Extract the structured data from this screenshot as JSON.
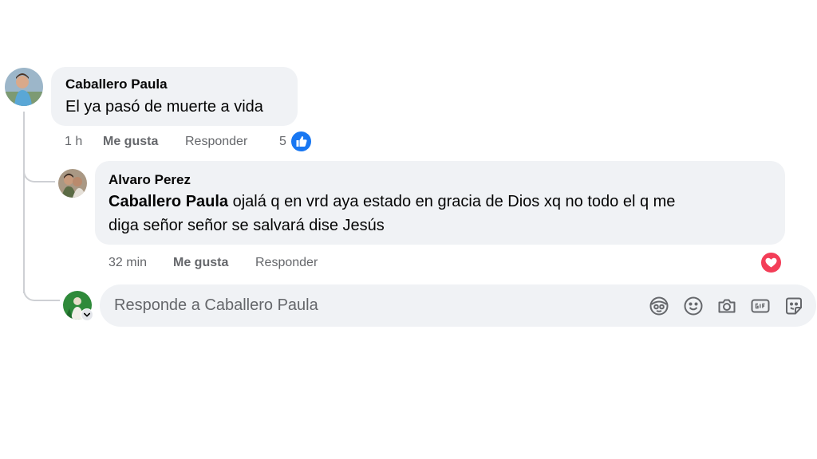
{
  "comment": {
    "author": "Caballero Paula",
    "text": "El ya pasó de muerte a vida",
    "time": "1 h",
    "like_label": "Me gusta",
    "reply_label": "Responder",
    "reaction_count": "5",
    "reaction_icon": "like-reaction-icon",
    "reaction_color": "#1877f2"
  },
  "reply": {
    "author": "Alvaro Perez",
    "mention": "Caballero Paula",
    "text_line1": " ojalá q en vrd aya estado en gracia de Dios xq no todo el q me",
    "text_line2": "diga señor señor se salvará dise Jesús",
    "time": "32 min",
    "like_label": "Me gusta",
    "reply_label": "Responder",
    "reaction_icon": "love-reaction-icon",
    "reaction_color": "#f33e58"
  },
  "reply_box": {
    "placeholder": "Responde a Caballero Paula",
    "tools": [
      "avatar-sticker-icon",
      "emoji-icon",
      "camera-icon",
      "gif-icon",
      "sticker-icon"
    ]
  }
}
